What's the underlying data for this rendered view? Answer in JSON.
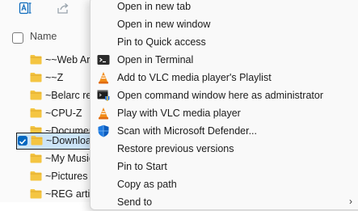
{
  "toolbar": {
    "buttons": [
      {
        "name": "rename-icon"
      },
      {
        "name": "share-icon"
      }
    ]
  },
  "columns": {
    "name_header": "Name"
  },
  "files": [
    {
      "name": "~~Web Art",
      "selected": false
    },
    {
      "name": "~~Z",
      "selected": false
    },
    {
      "name": "~Belarc rep",
      "selected": false
    },
    {
      "name": "~CPU-Z",
      "selected": false
    },
    {
      "name": "~Documen",
      "selected": false
    },
    {
      "name": "~Downloa",
      "selected": true
    },
    {
      "name": "~My Music",
      "selected": false
    },
    {
      "name": "~Pictures",
      "selected": false
    },
    {
      "name": "~REG articl",
      "selected": false
    }
  ],
  "context_menu": {
    "items": [
      {
        "label": "Open in new tab",
        "icon": null
      },
      {
        "label": "Open in new window",
        "icon": null
      },
      {
        "label": "Pin to Quick access",
        "icon": null
      },
      {
        "label": "Open in Terminal",
        "icon": "terminal-icon"
      },
      {
        "label": "Add to VLC media player's Playlist",
        "icon": "vlc-icon"
      },
      {
        "label": "Open command window here as administrator",
        "icon": "cmd-admin-icon"
      },
      {
        "label": "Play with VLC media player",
        "icon": "vlc-icon"
      },
      {
        "label": "Scan with Microsoft Defender...",
        "icon": "defender-shield-icon"
      },
      {
        "label": "Restore previous versions",
        "icon": null
      },
      {
        "label": "Pin to Start",
        "icon": null
      },
      {
        "label": "Copy as path",
        "icon": null
      },
      {
        "label": "Send to",
        "icon": null,
        "submenu": true
      }
    ]
  },
  "colors": {
    "selection": "#cce4f7",
    "accent": "#0067c0",
    "folder": "#f4c542",
    "menu_bg": "#f9f9f9"
  }
}
